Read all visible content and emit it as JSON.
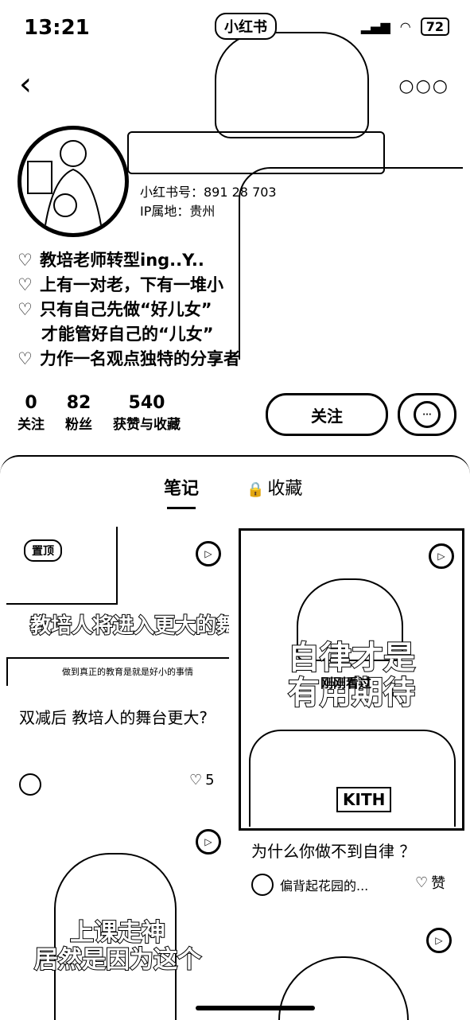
{
  "status": {
    "time": "13:21",
    "app_pill": "小红书",
    "battery": "72"
  },
  "nav": {
    "back_icon": "chevron-left-icon",
    "more_icon": "more-dots-icon"
  },
  "profile": {
    "id_line": "小红书号：891 28 703",
    "ip_line": "IP属地：贵州",
    "bio": [
      "教培老师转型ing..Y..",
      "上有一对老，下有一堆小",
      "只有自己先做“好儿女”",
      "才能管好自己的“儿女”",
      "力作一名观点独特的分享者"
    ]
  },
  "stats": [
    {
      "num": "0",
      "label": "关注"
    },
    {
      "num": "82",
      "label": "粉丝"
    },
    {
      "num": "540",
      "label": "获赞与收藏"
    }
  ],
  "actions": {
    "follow": "关注",
    "chat_icon": "chat-icon"
  },
  "tabs": {
    "notes": "笔记",
    "favorites": "收藏"
  },
  "cards": [
    {
      "pin": "置顶",
      "cover_text": "教培人将进入更大的舞台",
      "cover_sub": "做到真正的教育是就是好小的事情",
      "title": "双减后 教培人的舞台更大?",
      "author": "",
      "likes": "5"
    },
    {
      "cover_text_top": "自律才是",
      "cover_text_bottom": "有用期待",
      "cover_watermark": "刚刚看过",
      "shirt": "KITH",
      "title": "为什么你做不到自律 ？",
      "author": "偏背起花园的...",
      "likes": "赞"
    },
    {
      "cover_text_top": "上课走神",
      "cover_text_bottom": "居然是因为这个"
    }
  ]
}
